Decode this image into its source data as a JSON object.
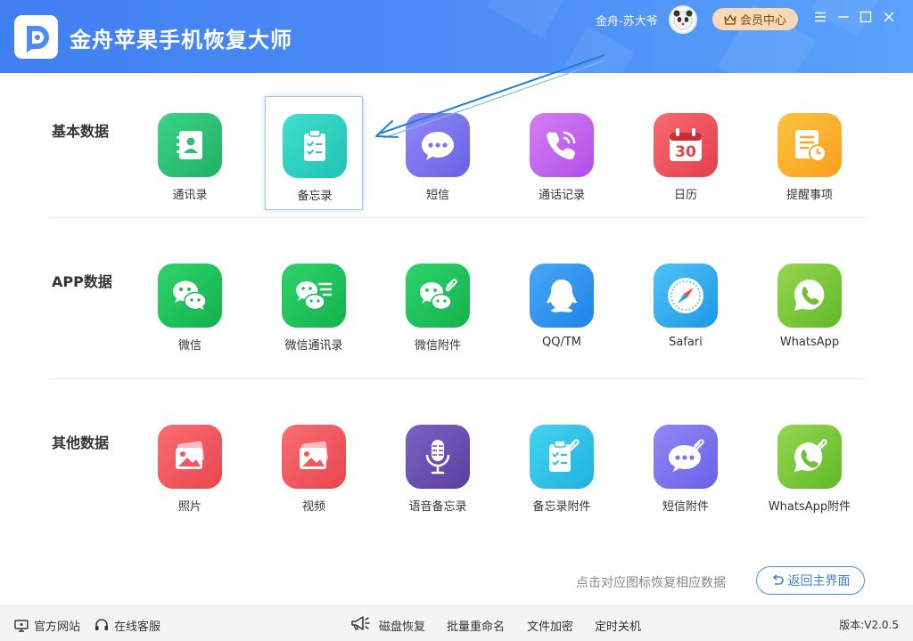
{
  "header": {
    "title": "金舟苹果手机恢复大师",
    "user_name": "金舟-苏大爷",
    "vip_label": "会员中心"
  },
  "colors": {
    "header": "#4a8cf5",
    "accent": "#3c7fe6"
  },
  "sections": [
    {
      "label": "基本数据",
      "items": [
        {
          "label": "通讯录",
          "icon": "contacts-icon",
          "color": "#2fc277"
        },
        {
          "label": "备忘录",
          "icon": "memo-icon",
          "color": "#2fd2c4"
        },
        {
          "label": "短信",
          "icon": "sms-icon",
          "color": "#7c74f1"
        },
        {
          "label": "通话记录",
          "icon": "call-log-icon",
          "color": "#c364ed"
        },
        {
          "label": "日历",
          "icon": "calendar-icon",
          "color": "#f3545b",
          "day": "30"
        },
        {
          "label": "提醒事项",
          "icon": "reminder-icon",
          "color": "#fbb02a"
        }
      ]
    },
    {
      "label": "APP数据",
      "items": [
        {
          "label": "微信",
          "icon": "wechat-icon",
          "color": "#1fc25c"
        },
        {
          "label": "微信通讯录",
          "icon": "wechat-contacts-icon",
          "color": "#1fc25c"
        },
        {
          "label": "微信附件",
          "icon": "wechat-attachment-icon",
          "color": "#1fc25c"
        },
        {
          "label": "QQ/TM",
          "icon": "qq-icon",
          "color": "#2e95f0"
        },
        {
          "label": "Safari",
          "icon": "safari-icon",
          "color": "#2eaef0"
        },
        {
          "label": "WhatsApp",
          "icon": "whatsapp-icon",
          "color": "#7cc93a"
        }
      ]
    },
    {
      "label": "其他数据",
      "items": [
        {
          "label": "照片",
          "icon": "photo-icon",
          "color": "#f3575d"
        },
        {
          "label": "视频",
          "icon": "video-icon",
          "color": "#f3575d"
        },
        {
          "label": "语音备忘录",
          "icon": "voice-memo-icon",
          "color": "#6a4fb0"
        },
        {
          "label": "备忘录附件",
          "icon": "memo-attachment-icon",
          "color": "#2cc4e6"
        },
        {
          "label": "短信附件",
          "icon": "sms-attachment-icon",
          "color": "#7c74f1"
        },
        {
          "label": "WhatsApp附件",
          "icon": "whatsapp-attachment-icon",
          "color": "#7cc93a"
        }
      ]
    }
  ],
  "hint": "点击对应图标恢复相应数据",
  "back_button": "返回主界面",
  "footer": {
    "left": [
      {
        "label": "官方网站",
        "icon": "monitor-icon"
      },
      {
        "label": "在线客服",
        "icon": "headset-icon"
      }
    ],
    "center_icon": "megaphone-icon",
    "center": [
      "磁盘恢复",
      "批量重命名",
      "文件加密",
      "定时关机"
    ],
    "version": "版本:V2.0.5"
  }
}
